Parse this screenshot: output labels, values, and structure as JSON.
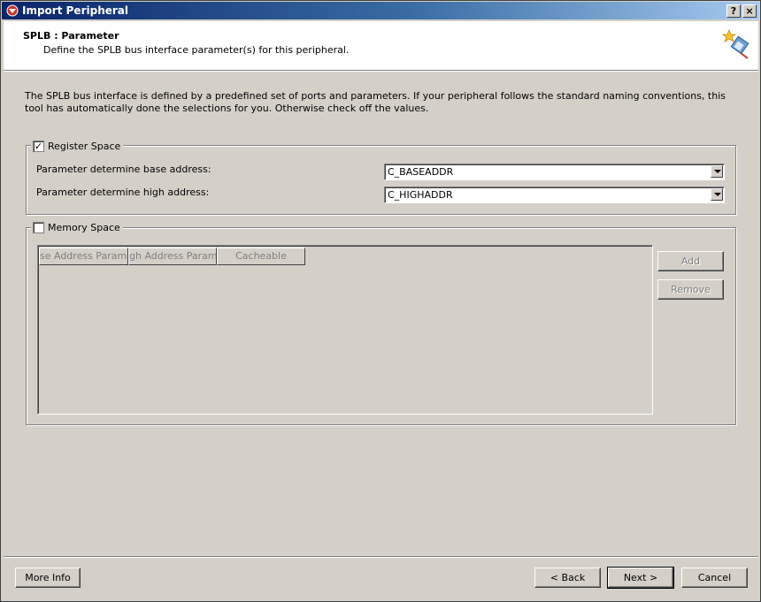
{
  "window": {
    "title": "Import Peripheral",
    "help_label": "?",
    "close_label": "×"
  },
  "header": {
    "title": "SPLB : Parameter",
    "subtitle": "Define the SPLB bus interface parameter(s) for this peripheral."
  },
  "description": "The SPLB bus interface is defined by a predefined set of ports and parameters. If your peripheral follows the standard naming conventions, this tool has automatically done the selections for you. Otherwise check off the values.",
  "register_space": {
    "checked": true,
    "label": "Register Space",
    "base_label": "Parameter determine base address:",
    "base_value": "C_BASEADDR",
    "high_label": "Parameter determine high address:",
    "high_value": "C_HIGHADDR"
  },
  "memory_space": {
    "checked": false,
    "label": "Memory Space",
    "columns": [
      "se Address Paramet",
      "gh Address Paramet",
      "Cacheable"
    ],
    "add_label": "Add",
    "remove_label": "Remove"
  },
  "footer": {
    "more_info": "More Info",
    "back": "< Back",
    "next": "Next >",
    "cancel": "Cancel"
  },
  "colors": {
    "titlebar_start": "#0a246a",
    "titlebar_end": "#a6caf0",
    "face": "#d4d0c8"
  }
}
